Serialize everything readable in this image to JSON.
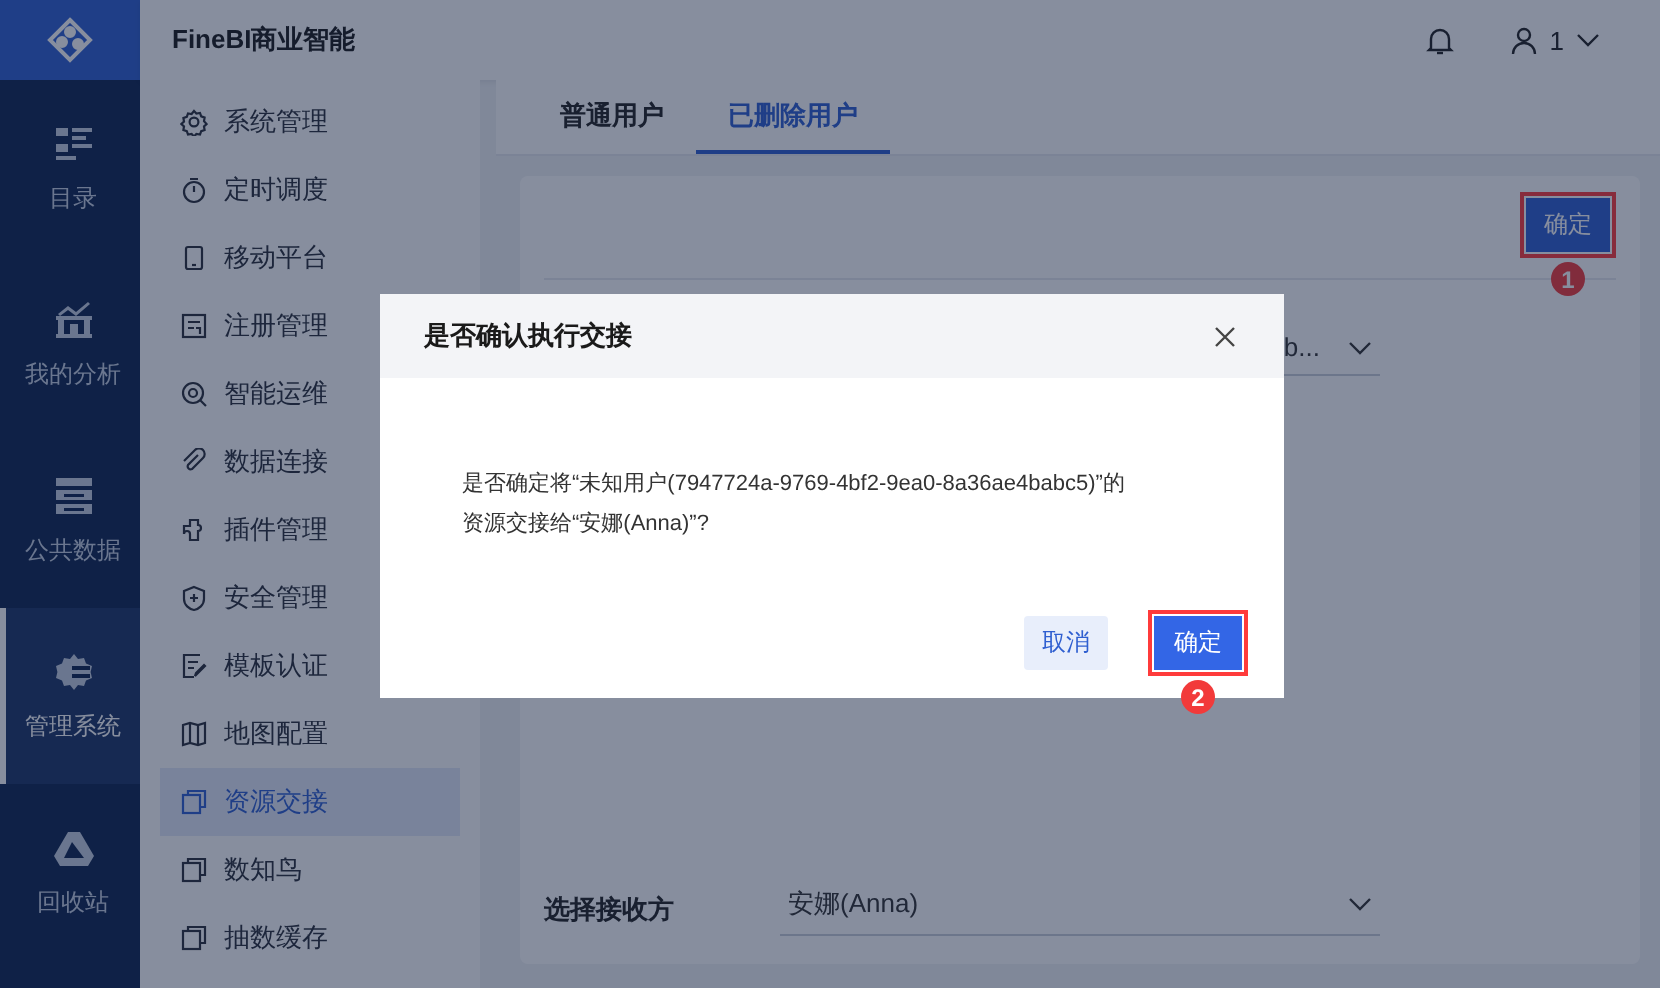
{
  "header": {
    "title": "FineBI商业智能",
    "user": "1"
  },
  "rail": [
    {
      "label": "目录",
      "selected": false
    },
    {
      "label": "我的分析",
      "selected": false
    },
    {
      "label": "公共数据",
      "selected": false
    },
    {
      "label": "管理系统",
      "selected": true
    },
    {
      "label": "回收站",
      "selected": false
    }
  ],
  "sidebar": [
    {
      "label": "系统管理",
      "selected": false
    },
    {
      "label": "定时调度",
      "selected": false
    },
    {
      "label": "移动平台",
      "selected": false
    },
    {
      "label": "注册管理",
      "selected": false
    },
    {
      "label": "智能运维",
      "selected": false
    },
    {
      "label": "数据连接",
      "selected": false
    },
    {
      "label": "插件管理",
      "selected": false
    },
    {
      "label": "安全管理",
      "selected": false
    },
    {
      "label": "模板认证",
      "selected": false
    },
    {
      "label": "地图配置",
      "selected": false
    },
    {
      "label": "资源交接",
      "selected": true
    },
    {
      "label": "数知鸟",
      "selected": false
    },
    {
      "label": "抽数缓存",
      "selected": false
    }
  ],
  "tabs": [
    {
      "label": "普通用户",
      "selected": false
    },
    {
      "label": "已删除用户",
      "selected": true
    }
  ],
  "content": {
    "confirm_button": "确定",
    "user_field": {
      "value": "b..."
    },
    "receiver": {
      "label": "选择接收方",
      "value": "安娜(Anna)"
    }
  },
  "dialog": {
    "title": "是否确认执行交接",
    "message": "是否确定将“未知用户(7947724a-9769-4bf2-9ea0-8a36ae4babc5)”的资源交接给“安娜(Anna)”?",
    "buttons": [
      {
        "label": "取消",
        "kind": "secondary"
      },
      {
        "label": "确定",
        "kind": "primary"
      }
    ]
  },
  "annotations": [
    {
      "label": "1"
    },
    {
      "label": "2"
    }
  ]
}
